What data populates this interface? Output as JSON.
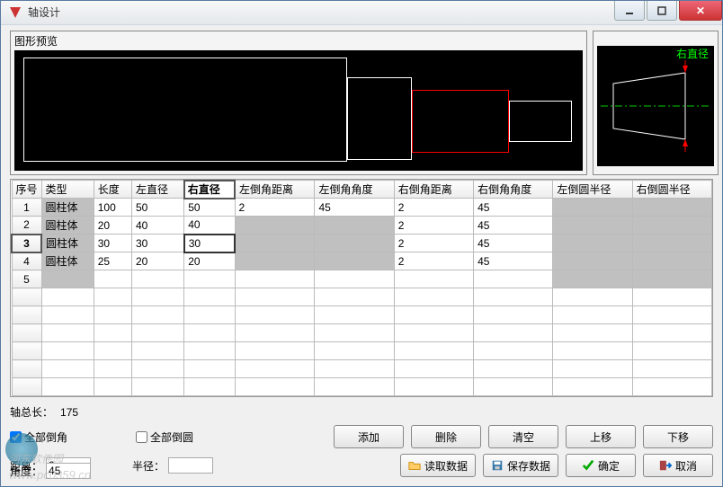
{
  "window": {
    "title": "轴设计"
  },
  "preview": {
    "label": "图形预览",
    "dim_label": "右直径"
  },
  "columns": [
    "序号",
    "类型",
    "长度",
    "左直径",
    "右直径",
    "左倒角距离",
    "左倒角角度",
    "右倒角距离",
    "右倒角角度",
    "左倒圆半径",
    "右倒圆半径"
  ],
  "active_col": 4,
  "active_row": 2,
  "rows": [
    {
      "n": "1",
      "type": "圆柱体",
      "len": "100",
      "ld": "50",
      "rd": "50",
      "lcd": "2",
      "lca": "45",
      "rcd": "2",
      "rca": "45",
      "lr": "",
      "rr": "",
      "gray_lr": true,
      "gray_rr": true,
      "gray_type": true
    },
    {
      "n": "2",
      "type": "圆柱体",
      "len": "20",
      "ld": "40",
      "rd": "40",
      "lcd": "",
      "lca": "",
      "rcd": "2",
      "rca": "45",
      "lr": "",
      "rr": "",
      "gray_lr": true,
      "gray_rr": true,
      "gray_type": true,
      "gray_lcd": true,
      "gray_lca": true
    },
    {
      "n": "3",
      "type": "圆柱体",
      "len": "30",
      "ld": "30",
      "rd": "30",
      "lcd": "",
      "lca": "",
      "rcd": "2",
      "rca": "45",
      "lr": "",
      "rr": "",
      "gray_lr": true,
      "gray_rr": true,
      "gray_type": true,
      "gray_lcd": true,
      "gray_lca": true,
      "active": true
    },
    {
      "n": "4",
      "type": "圆柱体",
      "len": "25",
      "ld": "20",
      "rd": "20",
      "lcd": "",
      "lca": "",
      "rcd": "2",
      "rca": "45",
      "lr": "",
      "rr": "",
      "gray_lr": true,
      "gray_rr": true,
      "gray_type": true,
      "gray_lcd": true,
      "gray_lca": true
    },
    {
      "n": "5",
      "type": "",
      "len": "",
      "ld": "",
      "rd": "",
      "lcd": "",
      "lca": "",
      "rcd": "",
      "rca": "",
      "lr": "",
      "rr": "",
      "gray_type": true,
      "gray_lr": true,
      "gray_rr": true
    }
  ],
  "total_length": {
    "label": "轴总长：",
    "value": "175"
  },
  "checks": {
    "all_chamfer": {
      "label": "全部倒角",
      "checked": true
    },
    "all_fillet": {
      "label": "全部倒圆",
      "checked": false
    },
    "dist": {
      "label": "距离：",
      "value": "2"
    },
    "angle": {
      "label": "角度：",
      "value": "45"
    },
    "radius": {
      "label": "半径：",
      "value": ""
    }
  },
  "buttons": {
    "add": "添加",
    "del": "删除",
    "clear": "清空",
    "up": "上移",
    "down": "下移",
    "load": "读取数据",
    "save": "保存数据",
    "ok": "确定",
    "cancel": "取消"
  },
  "watermark": {
    "text": "河东软件园",
    "url": "www.pc0359.cn"
  }
}
